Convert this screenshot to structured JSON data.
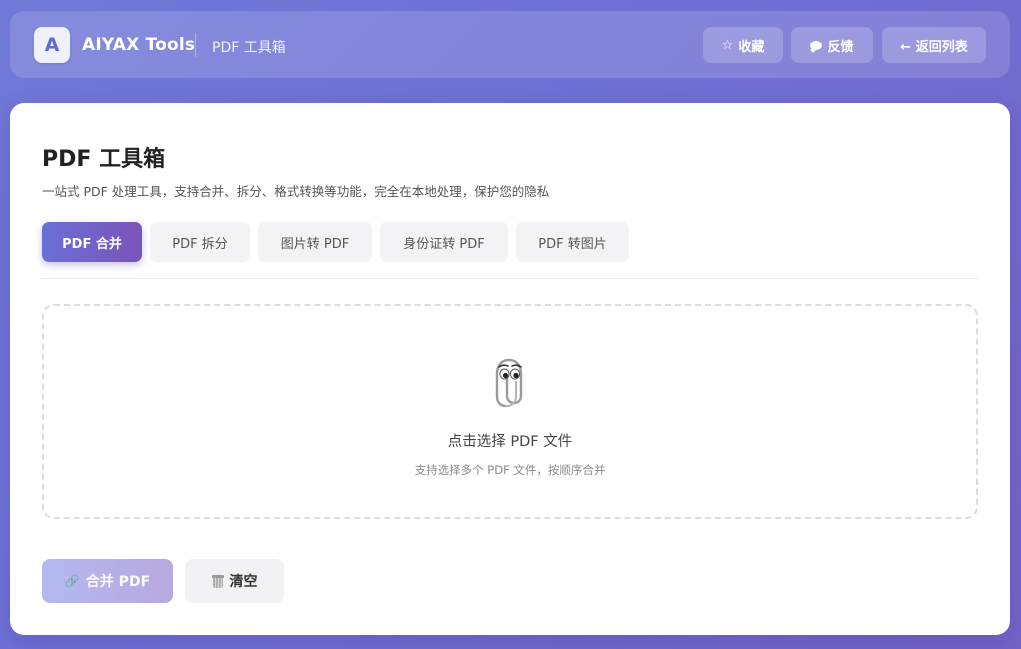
{
  "header": {
    "logo_letter": "A",
    "brand": "AIYAX Tools",
    "subtitle": "PDF 工具箱",
    "buttons": {
      "favorite": {
        "icon": "☆",
        "label": "收藏"
      },
      "feedback": {
        "label": "反馈"
      },
      "back": {
        "label": "← 返回列表"
      }
    }
  },
  "main": {
    "title": "PDF 工具箱",
    "description": "一站式 PDF 处理工具，支持合并、拆分、格式转换等功能，完全在本地处理，保护您的隐私",
    "tabs": [
      {
        "label": "PDF 合并",
        "active": true
      },
      {
        "label": "PDF 拆分",
        "active": false
      },
      {
        "label": "图片转 PDF",
        "active": false
      },
      {
        "label": "身份证转 PDF",
        "active": false
      },
      {
        "label": "PDF 转图片",
        "active": false
      }
    ],
    "dropzone": {
      "icon": "paperclip-icon",
      "title": "点击选择 PDF 文件",
      "hint": "支持选择多个 PDF 文件，按顺序合并"
    },
    "actions": {
      "merge": {
        "icon": "🔗",
        "label": "合并 PDF"
      },
      "clear": {
        "label": "清空"
      }
    }
  },
  "colors": {
    "background_gradient": [
      "#7079d8",
      "#7564c6"
    ],
    "tab_active_gradient": [
      "#6a6fd8",
      "#7a55b8"
    ],
    "merge_button_disabled": [
      "#b3b9f0",
      "#b8a8df"
    ]
  }
}
